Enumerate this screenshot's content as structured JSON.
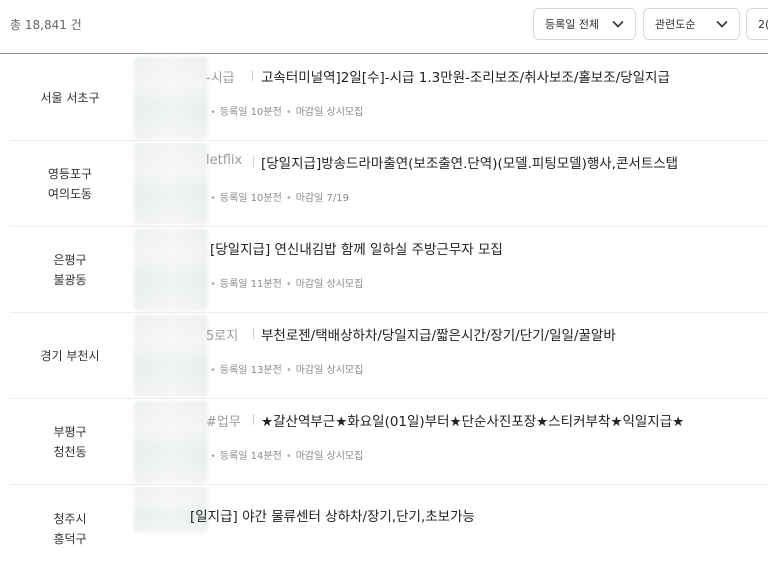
{
  "header": {
    "total": "총 18,841 건",
    "filters": [
      {
        "label": "등록일 전체"
      },
      {
        "label": "관련도순"
      },
      {
        "label": "2("
      }
    ]
  },
  "rows": [
    {
      "region": [
        "서울 서초구"
      ],
      "company": "-시급",
      "title": "고속터미널역]2일[수]-시급 1.3만원-조리보조/취사보조/홀보조/당일지급",
      "registered": "등록일 10분전",
      "deadline": "마감일 상시모집"
    },
    {
      "region": [
        "영등포구",
        "여의도동"
      ],
      "company": "letflix",
      "title": "[당일지급]방송드라마출연(보조출연.단역)(모델.피팅모델)행사,콘서트스탭",
      "registered": "등록일 10분전",
      "deadline": "마감일 7/19"
    },
    {
      "region": [
        "은평구",
        "불광동"
      ],
      "company": "",
      "title": "[당일지급] 연신내김밥 함께 일하실 주방근무자 모집",
      "registered": "등록일 11분전",
      "deadline": "마감일 상시모집"
    },
    {
      "region": [
        "경기 부천시"
      ],
      "company": "5로지",
      "title": "부천로젠/택배상하차/당일지급/짧은시간/장기/단기/일일/꿀알바",
      "registered": "등록일 13분전",
      "deadline": "마감일 상시모집"
    },
    {
      "region": [
        "부평구",
        "청천동"
      ],
      "company": "#업무",
      "title": "★갈산역부근★화요일(01일)부터★단순사진포장★스티커부착★익일지급★",
      "registered": "등록일 14분전",
      "deadline": "마감일 상시모집"
    },
    {
      "region": [
        "청주시",
        "흥덕구"
      ],
      "company": "",
      "title": "[일지급] 야간 물류센터 상하차/장기,단기,초보가능",
      "registered": "",
      "deadline": ""
    }
  ]
}
